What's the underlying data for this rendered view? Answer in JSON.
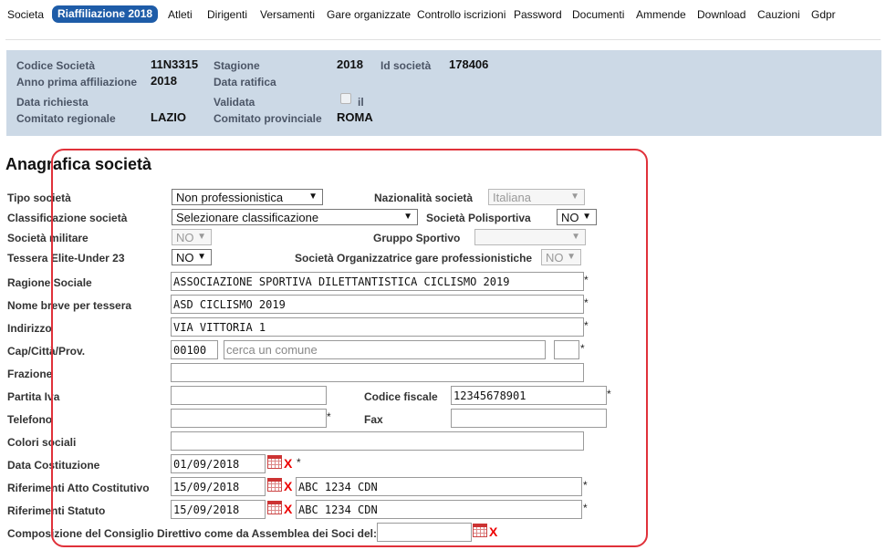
{
  "nav": {
    "items": [
      "Societa",
      "Riaffiliazione 2018",
      "Atleti",
      "Dirigenti",
      "Versamenti",
      "Gare organizzate",
      "Controllo iscrizioni",
      "Password",
      "Documenti",
      "Ammende",
      "Download",
      "Cauzioni",
      "Gdpr"
    ],
    "active_index": 1
  },
  "info": {
    "codice_label": "Codice Società",
    "codice_value": "11N3315",
    "stagione_label": "Stagione",
    "stagione_value": "2018",
    "id_label": "Id società",
    "id_value": "178406",
    "anno_label": "Anno prima affiliazione",
    "anno_value": "2018",
    "ratifica_label": "Data ratifica",
    "richiesta_label": "Data richiesta",
    "validata_label": "Validata",
    "validata_il": "il",
    "comitato_reg_label": "Comitato regionale",
    "comitato_reg_value": "LAZIO",
    "comitato_prov_label": "Comitato provinciale",
    "comitato_prov_value": "ROMA"
  },
  "section_title": "Anagrafica società",
  "form": {
    "tipo_label": "Tipo società",
    "tipo_value": "Non professionistica",
    "nazionalita_label": "Nazionalità società",
    "nazionalita_value": "Italiana",
    "classificazione_label": "Classificazione società",
    "classificazione_value": "Selezionare classificazione",
    "polisportiva_label": "Società Polisportiva",
    "polisportiva_value": "NO",
    "militare_label": "Società militare",
    "militare_value": "NO",
    "gruppo_label": "Gruppo Sportivo",
    "gruppo_value": "",
    "elite_label": "Tessera Elite-Under 23",
    "elite_value": "NO",
    "organizzatrice_label": "Società Organizzatrice gare professionistiche",
    "organizzatrice_value": "NO",
    "ragione_label": "Ragione Sociale",
    "ragione_value": "ASSOCIAZIONE SPORTIVA DILETTANTISTICA CICLISMO 2019",
    "nome_breve_label": "Nome breve per tessera",
    "nome_breve_value": "ASD CICLISMO 2019",
    "indirizzo_label": "Indirizzo",
    "indirizzo_value": "VIA VITTORIA 1",
    "cap_label": "Cap/Città/Prov.",
    "cap_value": "00100",
    "comune_placeholder": "cerca un comune",
    "prov_value": "",
    "frazione_label": "Frazione",
    "frazione_value": "",
    "piva_label": "Partita Iva",
    "piva_value": "",
    "cf_label": "Codice fiscale",
    "cf_value": "12345678901",
    "telefono_label": "Telefono",
    "telefono_value": "",
    "fax_label": "Fax",
    "fax_value": "",
    "colori_label": "Colori sociali",
    "colori_value": "",
    "costituzione_label": "Data Costituzione",
    "costituzione_value": "01/09/2018",
    "atto_label": "Riferimenti Atto Costitutivo",
    "atto_date": "15/09/2018",
    "atto_ref": "ABC 1234 CDN",
    "statuto_label": "Riferimenti Statuto",
    "statuto_date": "15/09/2018",
    "statuto_ref": "ABC 1234 CDN",
    "consiglio_label": "Composizione del Consiglio Direttivo come da Assemblea dei Soci del:",
    "consiglio_value": "",
    "required_mark": "*",
    "clear_mark": "X",
    "dropdown_arrow": "▼"
  },
  "icons": {
    "calendar": "calendar-icon",
    "clear": "clear-date-icon",
    "dropdown": "chevron-down-icon"
  },
  "colors": {
    "nav_active_bg": "#1e5ca8",
    "info_panel_bg": "#ccd9e6",
    "highlight_border": "#e0313a",
    "clear_red": "#e00000"
  }
}
